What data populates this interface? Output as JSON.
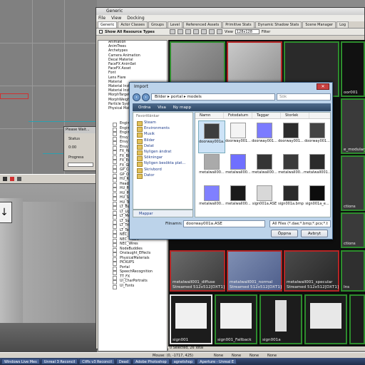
{
  "generic": {
    "title": "Generic",
    "menu": [
      "File",
      "View",
      "Docking"
    ],
    "tabs": [
      "Generic",
      "Actor Classes",
      "Groups",
      "Level",
      "Referenced Assets",
      "Primitive Stats",
      "Dynamic Shadow Stats",
      "Scene Manager",
      "Log"
    ],
    "show_all_label": "Show All Resource Types",
    "view_label": "View",
    "view_value": "128x128",
    "filter_label": "Filter",
    "resource_types": [
      "Animation",
      "AnimTrees",
      "Archetypes",
      "Camera Animation",
      "Decal Material",
      "FaceFX AnimSet",
      "FaceFX Asset",
      "Font",
      "Lens Flare",
      "Material",
      "Material Instan",
      "Material Instan",
      "MorphTargetSe",
      "MorphWeightS",
      "Particle System",
      "Physical Material"
    ],
    "packages": [
      "Engine",
      "Engine",
      "Engine",
      "Envy",
      "Envy",
      "Envy",
      "FX_Ha",
      "FX_Blu",
      "FX_Ev",
      "FX_Gl",
      "GP_Co",
      "GP_Or",
      "HU_Rl",
      "Heads",
      "HU_Pa",
      "HU_Pr",
      "HU_Sp",
      "HU_Te",
      "LT_Bu",
      "LT_Light",
      "LT_Mech",
      "LT_Support",
      "LT_Trim",
      "LT_TexFX",
      "NEC_Doors",
      "NEC_Pillars",
      "NEC_Wires",
      "NodeBuddies",
      "Onslaught_Effects",
      "PhysicalMaterials",
      "PICKUPS",
      "Portal",
      "SpeechRecognition",
      "TT_FX",
      "UI_CharPortraits",
      "UI_Fonts"
    ],
    "status": "0 Selected, 26 Total",
    "thumbnails": [
      {
        "caption": "metalwall001_diffuse",
        "info": "Streamed 512x512[DXT1]"
      },
      {
        "caption": "metalwall001_normal",
        "info": "Streamed 512x512[DXT1]"
      },
      {
        "caption": "metalwall001_specular",
        "info": "Streamed 512x512[DXT1]"
      },
      {
        "caption": "sign001",
        "info": ""
      },
      {
        "caption": "sign001_Fallback",
        "info": ""
      },
      {
        "caption": "sign001a",
        "info": ""
      }
    ],
    "right_captions": [
      "oor001",
      "e_modular_wa",
      "ctions",
      "ctions",
      "Ins"
    ]
  },
  "wait_dialog": {
    "title": "Please Wait...",
    "status": "Status",
    "time": "0:00",
    "progress": "Progress"
  },
  "import_dialog": {
    "title": "Import",
    "path": [
      "Bilder",
      "portal",
      "models"
    ],
    "search_placeholder": "Sök",
    "commands": [
      "Ordna",
      "Visa",
      "Ny mapp"
    ],
    "favorites_header": "Favoritlänkar",
    "favorites": [
      "Steam",
      "Environments",
      "Musik",
      "Bilder",
      "Delat",
      "Nyligen ändrat",
      "Sökningar",
      "Nyligen besökta plat...",
      "Skrivbord",
      "Dator"
    ],
    "folders_label": "Mappar",
    "columns": [
      "Namn",
      "Fotodatum",
      "Taggar",
      "Storlek"
    ],
    "files": [
      "doorway001a.ASE",
      "doorway001...",
      "doorway001...",
      "doorway001...",
      "doorway001...",
      "metalwall00...",
      "metalwall00...",
      "metalwall00...",
      "metalwall00...",
      "metalwall001...",
      "metalwall00...",
      "metalwall00...",
      "sign001a.ASE",
      "sign001a.bmp",
      "sign001a_e...",
      "sign001a_n..."
    ],
    "filename_label": "Filnamn:",
    "filename_value": "doorway001a.ASE",
    "filetype_value": "All Files (*.dae;*.bmp;*.pcx;*.t",
    "open_label": "Öppna",
    "cancel_label": "Avbryt"
  },
  "statusbar": {
    "mouse": "Mouse: (0, -1717, 425)",
    "items": [
      "None",
      "None",
      "None",
      "None"
    ]
  },
  "taskbar": [
    "Windows Live Mes",
    "Unreal 3 Reconcil",
    "Ctffs v3 Reconcil",
    "Dead",
    "Adobe Photoshop",
    "agnetshop",
    "Aperture - Unreal E"
  ]
}
